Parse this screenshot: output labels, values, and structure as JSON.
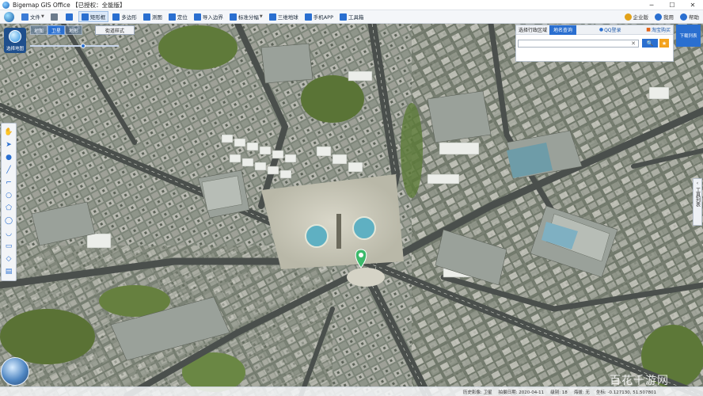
{
  "window": {
    "title": "Bigemap GIS Office 【已授权：全能版】",
    "controls": [
      "─",
      "☐",
      "✕"
    ]
  },
  "toolbar": {
    "items": [
      {
        "label": "文件",
        "icon": "folder-icon",
        "color": "#3b7bd6",
        "caret": true
      },
      {
        "label": "",
        "icon": "pan-hand-icon",
        "color": "#6b7b8c"
      },
      {
        "label": "",
        "icon": "location-pin-icon",
        "color": "#2a6fd0"
      },
      {
        "label": "矩形框",
        "icon": "rectangle-select-icon",
        "color": "#2a6fd0",
        "active": true
      },
      {
        "label": "多边形",
        "icon": "polygon-icon",
        "color": "#2a6fd0"
      },
      {
        "label": "测图",
        "icon": "measure-icon",
        "color": "#2a6fd0"
      },
      {
        "label": "定位",
        "icon": "locate-icon",
        "color": "#2a6fd0"
      },
      {
        "label": "导入边界",
        "icon": "import-boundary-icon",
        "color": "#2a6fd0"
      },
      {
        "label": "标准分幅",
        "icon": "grid-icon",
        "color": "#2a6fd0",
        "caret": true
      },
      {
        "label": "三维地球",
        "icon": "3d-icon",
        "color": "#2a6fd0"
      },
      {
        "label": "手机APP",
        "icon": "phone-icon",
        "color": "#2a6fd0"
      },
      {
        "label": "工具箱",
        "icon": "toolbox-icon",
        "color": "#2a6fd0"
      }
    ],
    "right_items": [
      {
        "label": "企业版",
        "icon": "crown-icon",
        "color": "#e2a21a"
      },
      {
        "label": "我用",
        "icon": "user-icon",
        "color": "#2a6fd0"
      },
      {
        "label": "帮助",
        "icon": "help-icon",
        "color": "#2a6fd0"
      }
    ]
  },
  "map_controls": {
    "brand": "选择地图",
    "map_types": [
      {
        "label": "地图",
        "active": false
      },
      {
        "label": "卫星",
        "active": true
      },
      {
        "label": "地形",
        "active": false
      }
    ],
    "street_style": "街道样式",
    "zoom_level_fraction": 0.6
  },
  "tool_strip": [
    {
      "icon": "hand-icon",
      "glyph": "✋"
    },
    {
      "icon": "pointer-icon",
      "glyph": "➤"
    },
    {
      "icon": "pin-icon",
      "glyph": "●"
    },
    {
      "icon": "line-icon",
      "glyph": "╱"
    },
    {
      "icon": "polyline-icon",
      "glyph": "⌐"
    },
    {
      "icon": "circle-icon",
      "glyph": "○"
    },
    {
      "icon": "polygon-icon",
      "glyph": "⬠"
    },
    {
      "icon": "ellipse-icon",
      "glyph": "◯"
    },
    {
      "icon": "arc-icon",
      "glyph": "◡"
    },
    {
      "icon": "rectangle-icon",
      "glyph": "▭"
    },
    {
      "icon": "eraser-icon",
      "glyph": "◇"
    },
    {
      "icon": "text-icon",
      "glyph": "▤"
    }
  ],
  "search": {
    "label": "选择行政区域",
    "active_tab": "地名查询",
    "links": [
      "QQ登录",
      "淘宝购买"
    ],
    "placeholder": "",
    "value": "",
    "search_glyph": "🔍",
    "fav_glyph": "★"
  },
  "download_list": "下载列表",
  "right_panel": {
    "label": "工具列表",
    "arrow": "‹"
  },
  "status": {
    "items": [
      "历史影像: 卫星",
      "拍摄日期: 2020-04-11",
      "级别: 18",
      "海拔: 无",
      "坐标: -0.127130, 51.507801"
    ]
  },
  "watermark": "百花千游网",
  "colors": {
    "accent": "#2a6fd0",
    "toolbar_bg": "#f4f6f9",
    "map_pin": "#3cb96b"
  }
}
